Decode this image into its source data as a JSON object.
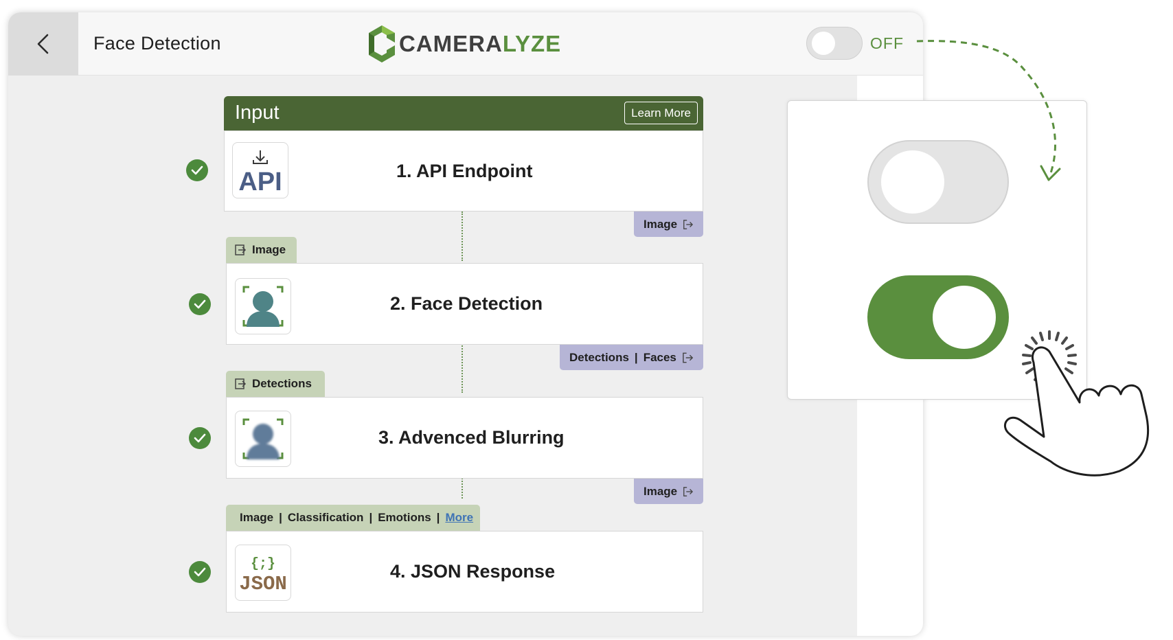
{
  "header": {
    "title": "Face Detection",
    "logo": {
      "text_main": "CAMERA",
      "text_accent": "LYZE",
      "icon": "cube-logo-icon"
    },
    "toggle": {
      "state_label": "OFF",
      "on": false
    }
  },
  "pipeline": {
    "input_header": {
      "label": "Input",
      "learn_more": "Learn More"
    },
    "steps": [
      {
        "title": "1. API Endpoint",
        "icon": "api-download-icon",
        "icon_text": "API",
        "status": "check-icon",
        "output": "Image"
      },
      {
        "title": "2. Face Detection",
        "icon": "face-scan-icon",
        "status": "check-icon",
        "input": "Image",
        "output": {
          "a": "Detections",
          "sep": "|",
          "b": "Faces"
        }
      },
      {
        "title": "3. Advenced Blurring",
        "icon": "blurred-face-icon",
        "status": "check-icon",
        "input": "Detections",
        "output": "Image"
      },
      {
        "title": "4. JSON Response",
        "icon": "json-icon",
        "icon_text_top": "{;}",
        "icon_text": "JSON",
        "status": "check-icon",
        "input": {
          "a": "Image",
          "b": "Classification",
          "c": "Emotions",
          "sep": "|",
          "more": "More"
        }
      }
    ]
  },
  "zoom_panel": {
    "toggle_off": {
      "on": false
    },
    "toggle_on": {
      "on": true
    },
    "pointer": "hand-pointer-icon"
  },
  "colors": {
    "brand_green": "#5a8f3e",
    "header_green": "#4a6534",
    "port_out": "#b6b5d6",
    "port_in": "#c6d3b7",
    "check": "#4c8a3c"
  }
}
